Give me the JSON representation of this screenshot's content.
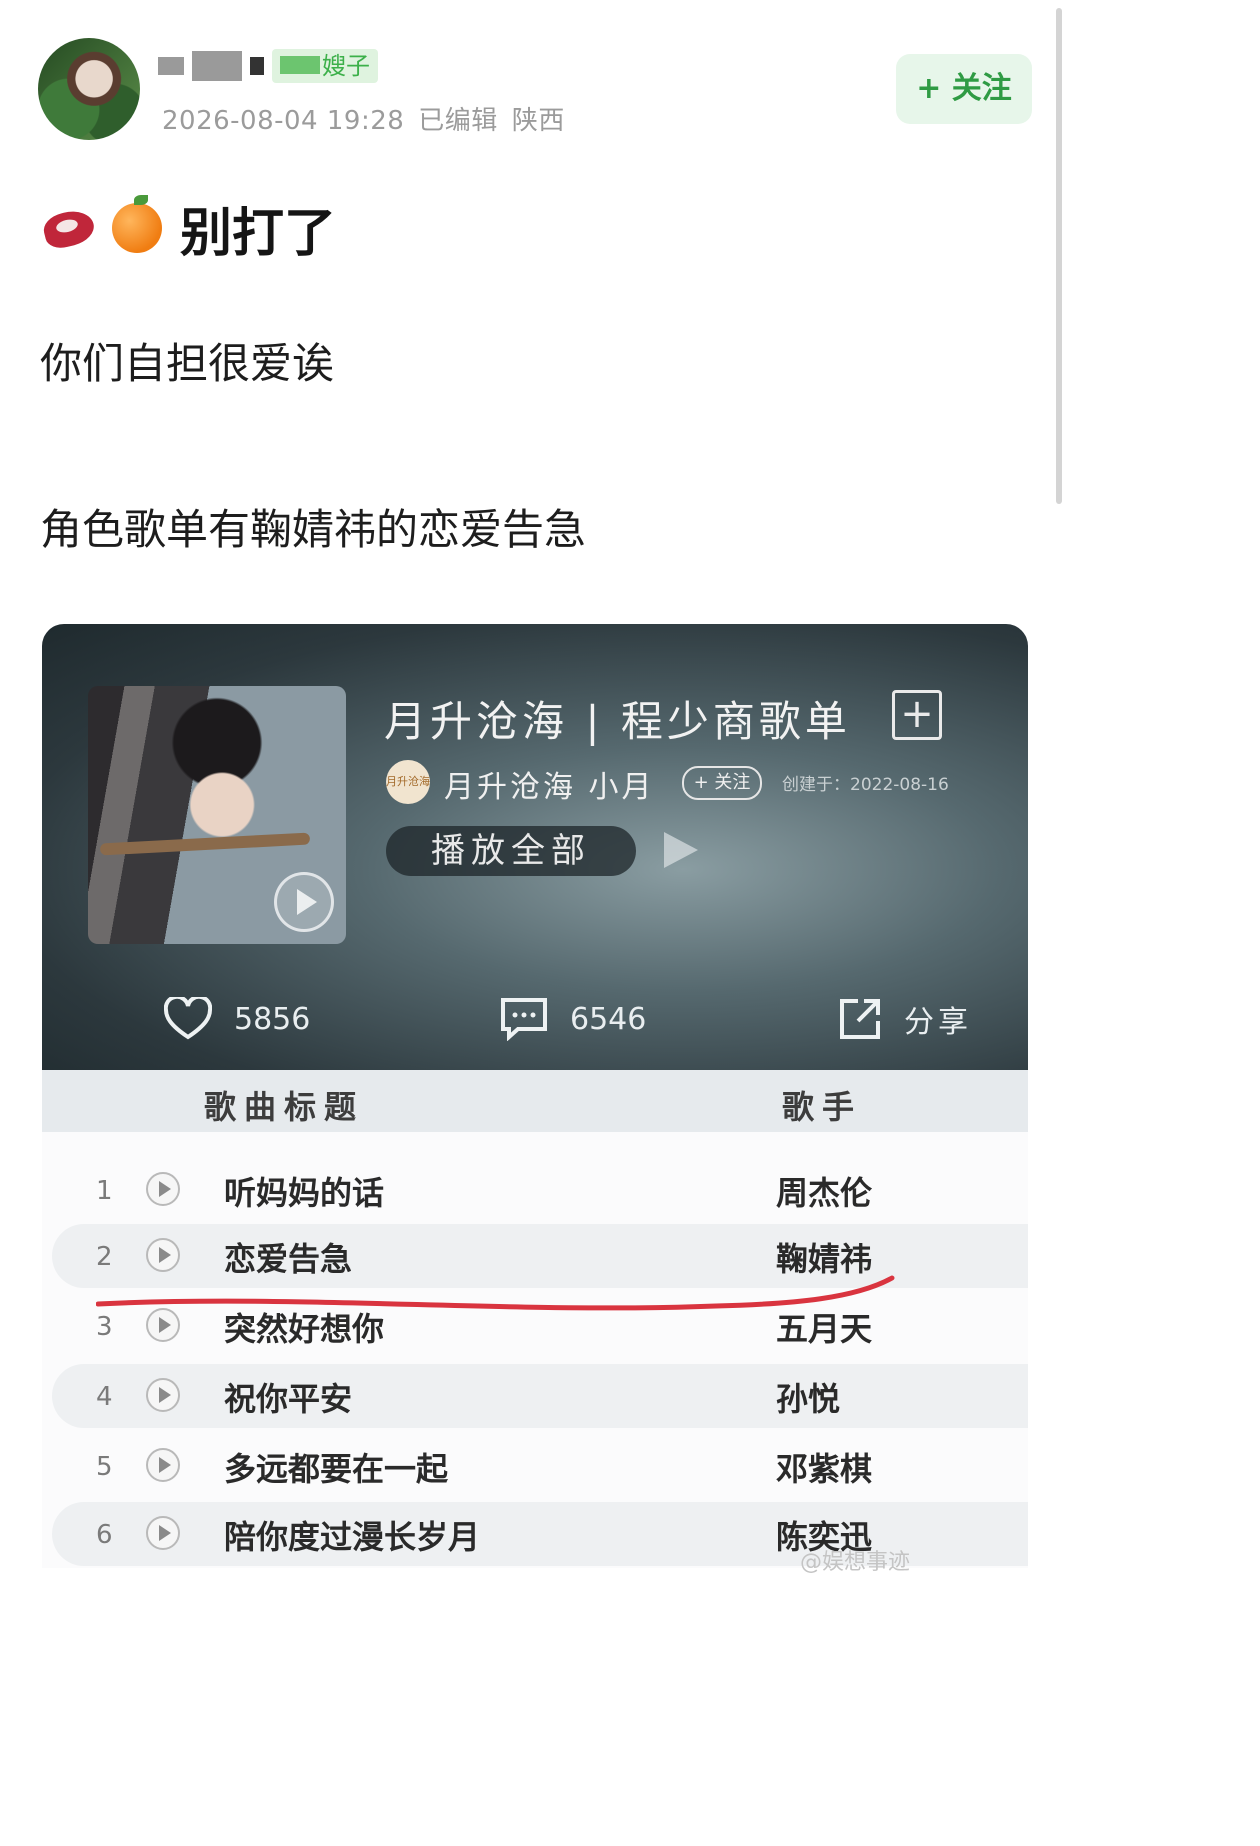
{
  "post": {
    "author_name_suffix": "嫂子",
    "timestamp": "2026-08-04 19:28",
    "edited_label": "已编辑",
    "location": "陕西",
    "follow_label": "+ 关注",
    "title": "别打了",
    "title_emojis": [
      "meat-emoji",
      "orange-emoji"
    ],
    "paragraphs": [
      "你们自担很爱诶",
      "角色歌单有鞠婧祎的恋爱告急"
    ]
  },
  "playlist": {
    "title": "月升沧海 | 程少商歌单",
    "owner_avatar_text": "月升沧海",
    "owner_name": "月升沧海 小月",
    "owner_follow_label": "+ 关注",
    "created_label": "创建于：2022-08-16",
    "play_all_label": "播放全部",
    "likes": "5856",
    "comments": "6546",
    "share_label": "分享",
    "header_song": "歌曲标题",
    "header_singer": "歌手",
    "songs": [
      {
        "num": "1",
        "title": "听妈妈的话",
        "singer": "周杰伦"
      },
      {
        "num": "2",
        "title": "恋爱告急",
        "singer": "鞠婧祎"
      },
      {
        "num": "3",
        "title": "突然好想你",
        "singer": "五月天"
      },
      {
        "num": "4",
        "title": "祝你平安",
        "singer": "孙悦"
      },
      {
        "num": "5",
        "title": "多远都要在一起",
        "singer": "邓紫棋"
      },
      {
        "num": "6",
        "title": "陪你度过漫长岁月",
        "singer": "陈奕迅"
      }
    ],
    "highlight_color": "#d9343f"
  },
  "watermark": "@娱想事迹"
}
